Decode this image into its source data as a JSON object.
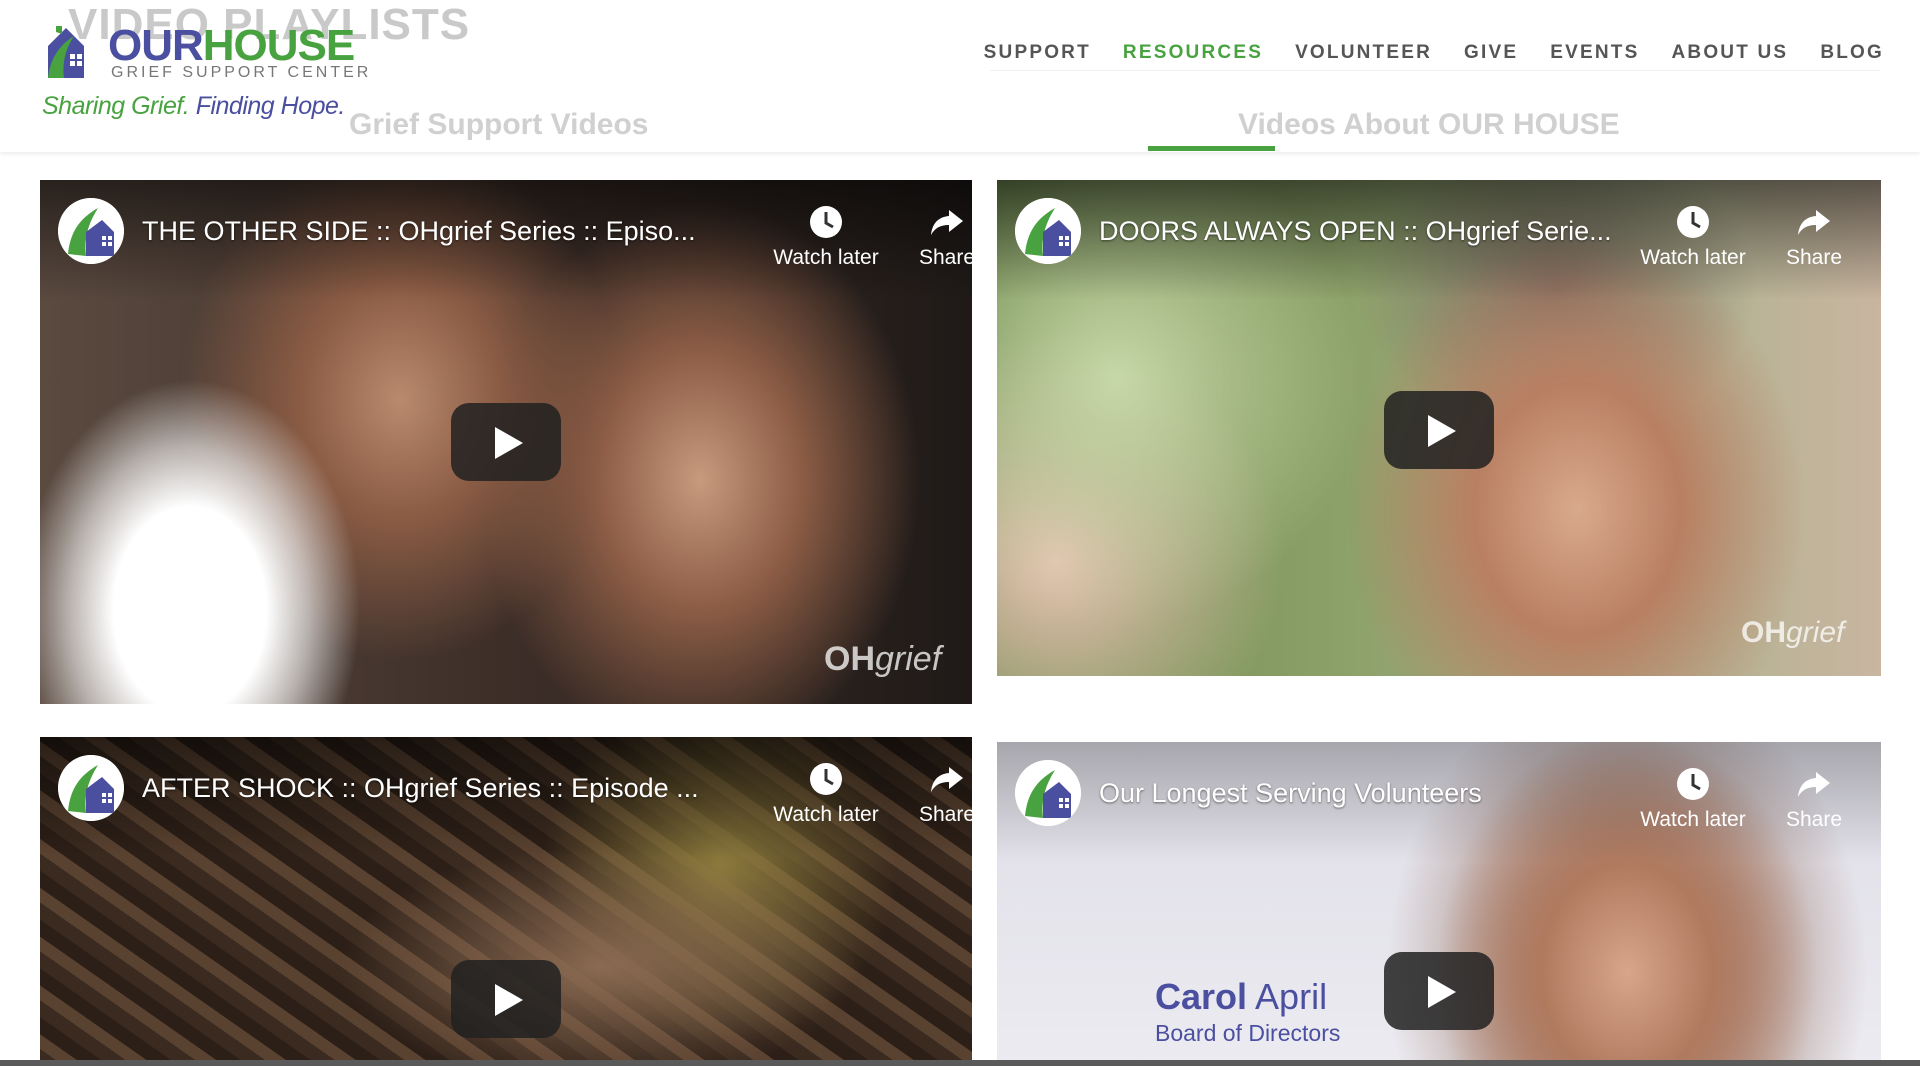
{
  "header": {
    "faded_heading": "VIDEO PLAYLISTS",
    "logo": {
      "word_our": "OUR",
      "word_house": "HOUSE",
      "subtitle": "GRIEF SUPPORT CENTER",
      "tagline_green": "Sharing Grief.",
      "tagline_purple": "Finding Hope."
    },
    "nav": [
      {
        "label": "SUPPORT",
        "active": false
      },
      {
        "label": "RESOURCES",
        "active": true
      },
      {
        "label": "VOLUNTEER",
        "active": false
      },
      {
        "label": "GIVE",
        "active": false
      },
      {
        "label": "EVENTS",
        "active": false
      },
      {
        "label": "ABOUT US",
        "active": false
      },
      {
        "label": "BLOG",
        "active": false
      }
    ],
    "tabs": [
      {
        "label": "Grief Support Videos"
      },
      {
        "label": "Videos About OUR HOUSE"
      }
    ]
  },
  "videos": [
    {
      "title": "THE OTHER SIDE :: OHgrief Series :: Episo...",
      "watch_later": "Watch later",
      "share": "Share",
      "watermark_bold": "OH",
      "watermark_italic": "grief"
    },
    {
      "title": "DOORS ALWAYS OPEN :: OHgrief Serie...",
      "watch_later": "Watch later",
      "share": "Share",
      "watermark_bold": "OH",
      "watermark_italic": "grief"
    },
    {
      "title": "AFTER SHOCK :: OHgrief Series :: Episode ...",
      "watch_later": "Watch later",
      "share": "Share"
    },
    {
      "title": "Our Longest Serving Volunteers",
      "watch_later": "Watch later",
      "share": "Share",
      "lower_third_first": "Carol",
      "lower_third_last": "April",
      "lower_third_role": "Board of Directors"
    }
  ],
  "colors": {
    "brand_green": "#48a23f",
    "brand_purple": "#4a4fa0"
  },
  "icons": [
    "clock-icon",
    "share-arrow-icon",
    "play-icon",
    "house-logo-icon"
  ]
}
